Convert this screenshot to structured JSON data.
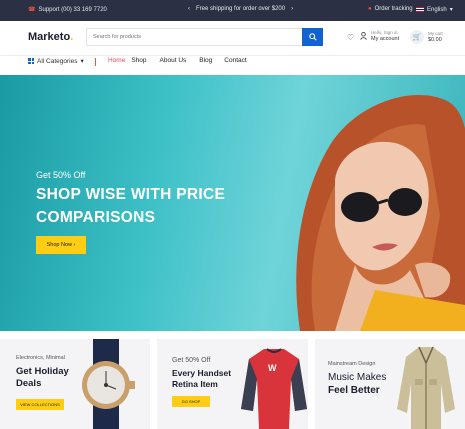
{
  "topbar": {
    "support": "Support (00) 33 169 7720",
    "shipping": "Free shipping for order over $200",
    "order_tracking": "Order tracking",
    "language": "English"
  },
  "header": {
    "logo": "Marketo",
    "logo_dot": ".",
    "search_placeholder": "Search for products",
    "account_small": "Hello, Sign in",
    "account_main": "My account",
    "cart_small": "My cart",
    "cart_main": "$0.00"
  },
  "nav": {
    "categories": "All Categories",
    "links": [
      "Home",
      "Shop",
      "About Us",
      "Blog",
      "Contact"
    ]
  },
  "hero": {
    "pre": "Get 50% Off",
    "title": "SHOP WISE WITH PRICE COMPARISONS",
    "button": "Shop Now"
  },
  "promos": [
    {
      "tag": "Electronics, Minimal",
      "title": "Get Holiday Deals",
      "cta": "VIEW COLLECTIONS"
    },
    {
      "tag": "Get 50% Off",
      "title": "Every Handset Retina Item",
      "cta": "GO SHOP"
    },
    {
      "tag": "Mainstream Design",
      "title_line1": "Music Makes",
      "title_line2": "Feel Better"
    }
  ],
  "colors": {
    "topbar_bg": "#2b3045",
    "accent_blue": "#1162d2",
    "accent_yellow": "#ffcd11",
    "home_link": "#e8465b",
    "hero_bg": "#3fc1c8"
  }
}
